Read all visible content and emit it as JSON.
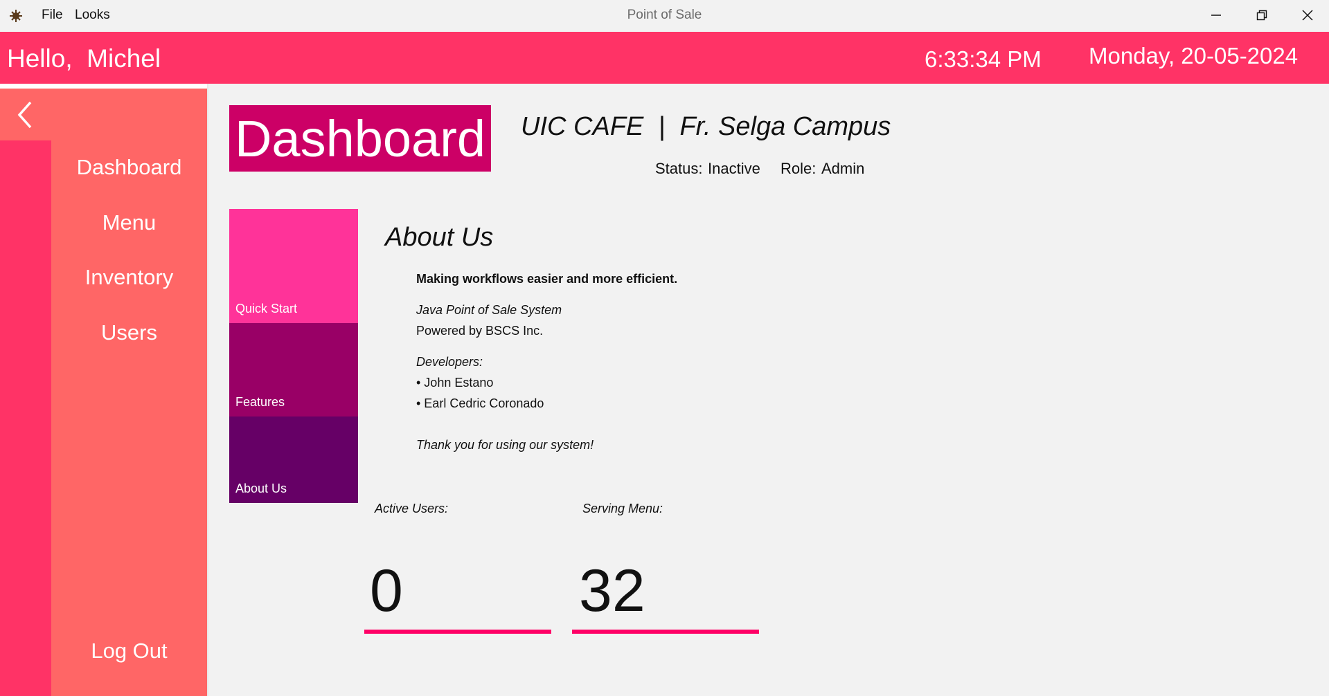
{
  "window": {
    "title": "Point of Sale",
    "menu": [
      "File",
      "Looks"
    ],
    "controls": [
      "minimize",
      "restore",
      "close"
    ]
  },
  "header": {
    "greeting": "Hello,  Michel",
    "time": "6:33:34 PM",
    "date": "Monday, 20-05-2024"
  },
  "sidebar": {
    "items": [
      {
        "label": "Dashboard"
      },
      {
        "label": "Menu"
      },
      {
        "label": "Inventory"
      },
      {
        "label": "Users"
      }
    ],
    "logout": "Log Out"
  },
  "page": {
    "badge": "Dashboard",
    "cafe": "UIC CAFE  |  Fr. Selga Campus",
    "status_label": "Status:",
    "status_value": "Inactive",
    "role_label": "Role:",
    "role_value": "Admin"
  },
  "tiles": [
    {
      "label": "Quick Start"
    },
    {
      "label": "Features"
    },
    {
      "label": "About Us"
    }
  ],
  "about": {
    "heading": "About Us",
    "tagline": "Making workflows easier and more efficient.",
    "system": "Java Point of Sale System",
    "powered": "Powered by BSCS Inc.",
    "developers_label": "Developers:",
    "developers": [
      "• John Estano",
      "• Earl Cedric Coronado"
    ],
    "thanks": "Thank you for using our system!"
  },
  "stats": {
    "active_users_label": "Active Users:",
    "active_users_value": "0",
    "serving_menu_label": "Serving Menu:",
    "serving_menu_value": "32"
  },
  "colors": {
    "header": "#ff3366",
    "sidebar": "#ff6666",
    "badge": "#cc0066",
    "tile_quick_start": "#ff3399",
    "tile_features": "#990066",
    "tile_about": "#660066",
    "stat_underline": "#ff0066"
  }
}
